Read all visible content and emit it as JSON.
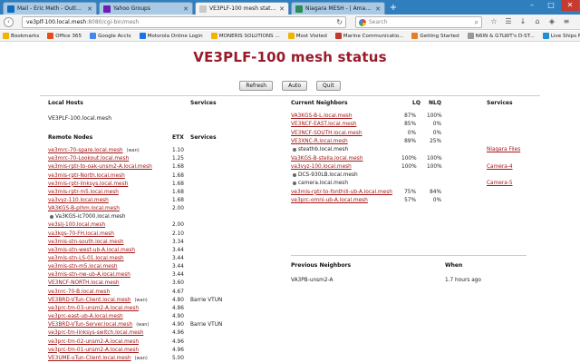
{
  "browser": {
    "tabs": [
      {
        "label": "Mail - Eric Meth - Outlook",
        "color": "#0f6cbd",
        "icon": "outlook-icon",
        "active": false
      },
      {
        "label": "Yahoo Groups",
        "color": "#6a1fb0",
        "icon": "yahoo-icon",
        "active": false
      },
      {
        "label": "VE3PLF-100 mesh status",
        "color": "#c9c9c9",
        "icon": "page-icon",
        "active": true
      },
      {
        "label": "Niagara MESH - | Amateu...",
        "color": "#2e8b57",
        "icon": "globe-icon",
        "active": false
      }
    ],
    "new_tab": "+",
    "window_controls": [
      "–",
      "□",
      "✕"
    ],
    "url_host": "ve3plf-100.local.mesh",
    "url_rest": ":8080/cgi-bin/mesh",
    "search_placeholder": "Search",
    "bookmarks": [
      {
        "label": "Bookmarks",
        "color": "#f0b400"
      },
      {
        "label": "Office 365",
        "color": "#e74c1c"
      },
      {
        "label": "Google Accts",
        "color": "#4285f4"
      },
      {
        "label": "Motorola Online Login",
        "color": "#1a73e8"
      },
      {
        "label": "MONERIS SOLUTIONS ...",
        "color": "#f0b400"
      },
      {
        "label": "Most Visited",
        "color": "#f0b400"
      },
      {
        "label": "Marine Communicatio...",
        "color": "#c0392b"
      },
      {
        "label": "Getting Started",
        "color": "#e67e22"
      },
      {
        "label": "N6IN & G7LWT's D-ST...",
        "color": "#999999"
      },
      {
        "label": "Live Ships Map - AIS - ...",
        "color": "#1f8fd6"
      }
    ]
  },
  "page": {
    "title": "VE3PLF-100 mesh status",
    "buttons": {
      "refresh": "Refresh",
      "auto": "Auto",
      "quit": "Quit"
    },
    "title_color": "#9a1a2a",
    "link_color": "#a31515"
  },
  "local": {
    "hosts_header": "Local Hosts",
    "services_header": "Services",
    "host": "VE3PLF-100.local.mesh"
  },
  "remote": {
    "header": "Remote Nodes",
    "etx_header": "ETX",
    "services_header": "Services",
    "nodes": [
      {
        "name": "ve3mrc-70-spare.local.mesh",
        "tag": "(wan)",
        "etx": "1.10",
        "svc": "",
        "link": true
      },
      {
        "name": "ve3mrc-70-Lookout.local.mesh",
        "tag": "",
        "etx": "1.25",
        "svc": "",
        "link": true
      },
      {
        "name": "ve3mis-rptr-to-oak-unsm2-A.local.mesh",
        "tag": "",
        "etx": "1.68",
        "svc": "",
        "link": true
      },
      {
        "name": "ve3mis-rptr-North.local.mesh",
        "tag": "",
        "etx": "1.68",
        "svc": "",
        "link": true
      },
      {
        "name": "ve3mis-rptr-linksys.local.mesh",
        "tag": "",
        "etx": "1.68",
        "svc": "",
        "link": true
      },
      {
        "name": "ve3mis-rptr-m5.local.mesh",
        "tag": "",
        "etx": "1.68",
        "svc": "",
        "link": true
      },
      {
        "name": "va3vyz-110.local.mesh",
        "tag": "",
        "etx": "1.68",
        "svc": "",
        "link": true
      },
      {
        "name": "VA3KGS-B-plhm.local.mesh",
        "tag": "",
        "etx": "2.00",
        "svc": "",
        "link": true
      },
      {
        "name": "Va3KGS-ic7000.local.mesh",
        "tag": "",
        "etx": "",
        "svc": "",
        "link": false,
        "dot": true
      },
      {
        "name": "ve3sij-100.local.mesh",
        "tag": "",
        "etx": "2.00",
        "svc": "",
        "link": true
      },
      {
        "name": "va3kgs-70-FH.local.mesh",
        "tag": "",
        "etx": "2.10",
        "svc": "",
        "link": true
      },
      {
        "name": "ve3mis-stn-south.local.mesh",
        "tag": "",
        "etx": "3.34",
        "svc": "",
        "link": true
      },
      {
        "name": "ve3mis-stn-west-ub-A.local.mesh",
        "tag": "",
        "etx": "3.44",
        "svc": "",
        "link": true
      },
      {
        "name": "ve3mis-stn-LS-01.local.mesh",
        "tag": "",
        "etx": "3.44",
        "svc": "",
        "link": true
      },
      {
        "name": "ve3mis-stn-m5.local.mesh",
        "tag": "",
        "etx": "3.44",
        "svc": "",
        "link": true
      },
      {
        "name": "ve3mis-stn-nw-ub-A.local.mesh",
        "tag": "",
        "etx": "3.44",
        "svc": "",
        "link": true
      },
      {
        "name": "VE3NCF-NORTH.local.mesh",
        "tag": "",
        "etx": "3.60",
        "svc": "",
        "link": true
      },
      {
        "name": "ve3nrc-70-B.local.mesh",
        "tag": "",
        "etx": "4.67",
        "svc": "",
        "link": true
      },
      {
        "name": "VE3BRD-VTun-Client.local.mesh",
        "tag": "(wan)",
        "etx": "4.80",
        "svc": "Barrie VTUN",
        "link": true
      },
      {
        "name": "ve3prc-tm-03-unsm2-A.local.mesh",
        "tag": "",
        "etx": "4.86",
        "svc": "",
        "link": true
      },
      {
        "name": "ve3prc-east-ub-A.local.mesh",
        "tag": "",
        "etx": "4.90",
        "svc": "",
        "link": true
      },
      {
        "name": "VE3BRD-VTun-Server.local.mesh",
        "tag": "(wan)",
        "etx": "4.90",
        "svc": "Barrie VTUN",
        "link": true
      },
      {
        "name": "ve3prc-tm-linksys-switch.local.mesh",
        "tag": "",
        "etx": "4.96",
        "svc": "",
        "link": true
      },
      {
        "name": "ve3prc-tm-02-unsm2-A.local.mesh",
        "tag": "",
        "etx": "4.96",
        "svc": "",
        "link": true
      },
      {
        "name": "ve3prc-tm-01-unsm2-A.local.mesh",
        "tag": "",
        "etx": "4.96",
        "svc": "",
        "link": true
      },
      {
        "name": "VE3UME-vTun-Client.local.mesh",
        "tag": "(wan)",
        "etx": "5.00",
        "svc": "",
        "link": true
      }
    ]
  },
  "neighbors": {
    "header": "Current Neighbors",
    "lq_header": "LQ",
    "nlq_header": "NLQ",
    "services_header": "Services",
    "rows": [
      {
        "name": "VA3KGS-B-L.local.mesh",
        "lq": "87%",
        "nlq": "100%",
        "svc": "",
        "link": true
      },
      {
        "name": "VE3NCF-EAST.local.mesh",
        "lq": "85%",
        "nlq": "0%",
        "svc": "",
        "link": true
      },
      {
        "name": "VE3NCF-SOUTH.local.mesh",
        "lq": "0%",
        "nlq": "0%",
        "svc": "",
        "link": true
      },
      {
        "name": "VE3XNC-R.local.mesh",
        "lq": "89%",
        "nlq": "25%",
        "svc": "",
        "link": true
      },
      {
        "name": "steathb.local.mesh",
        "lq": "",
        "nlq": "",
        "svc": "Niagara Files",
        "link": false,
        "dot": true
      },
      {
        "name": "Va3KGS-B-stella.local.mesh",
        "lq": "100%",
        "nlq": "100%",
        "svc": "",
        "link": true
      },
      {
        "name": "va3vyz-100.local.mesh",
        "lq": "100%",
        "nlq": "100%",
        "svc": "Camera-4",
        "link": true
      },
      {
        "name": "DCS-930LB.local.mesh",
        "lq": "",
        "nlq": "",
        "svc": "",
        "link": false,
        "dot": true
      },
      {
        "name": "camera.local.mesh",
        "lq": "",
        "nlq": "",
        "svc": "Camera-5",
        "link": false,
        "dot": true
      },
      {
        "name": "ve3mis-rptr-to-fonthill-ub-A.local.mesh",
        "lq": "75%",
        "nlq": "84%",
        "svc": "",
        "link": true
      },
      {
        "name": "ve3prc-omni-ub-A.local.mesh",
        "lq": "57%",
        "nlq": "0%",
        "svc": "",
        "link": true
      }
    ]
  },
  "previous": {
    "header": "Previous Neighbors",
    "when_header": "When",
    "rows": [
      {
        "name": "VA3PB-unsm2-A",
        "when": "1.7 hours ago"
      }
    ]
  }
}
